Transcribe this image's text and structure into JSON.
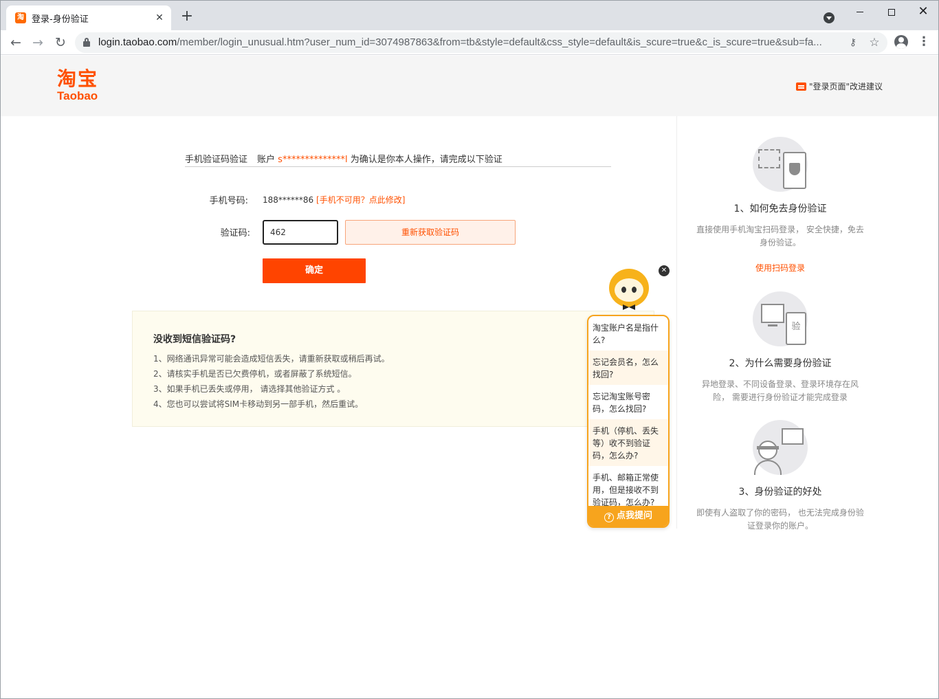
{
  "browser": {
    "tab_title": "登录-身份验证",
    "tab_favicon_text": "淘",
    "url_host": "login.taobao.com",
    "url_path": "/member/login_unusual.htm?user_num_id=3074987863&from=tb&style=default&css_style=default&is_scure=true&c_is_scure=true&sub=fa..."
  },
  "header": {
    "logo_cn": "淘宝",
    "logo_en": "Taobao",
    "feedback_label": "\"登录页面\"改进建议"
  },
  "verify": {
    "tab_label": "手机验证码验证",
    "account_prefix": "账户",
    "account_masked": "s**************l",
    "instruction": "为确认是你本人操作，请完成以下验证",
    "phone_label": "手机号码:",
    "phone_value": "188******86",
    "phone_change": "[手机不可用？点此修改]",
    "code_label": "验证码:",
    "code_value": "462",
    "resend_label": "重新获取验证码",
    "confirm_label": "确定"
  },
  "tips": {
    "title": "没收到短信验证码?",
    "items": [
      "1、网络通讯异常可能会造成短信丢失，请重新获取或稍后再试。",
      "2、请核实手机是否已欠费停机，或者屏蔽了系统短信。",
      "3、如果手机已丢失或停用， 请选择其他验证方式 。",
      "4、您也可以尝试将SIM卡移动到另一部手机，然后重试。"
    ]
  },
  "help": [
    {
      "title": "1、如何免去身份验证",
      "desc": "直接使用手机淘宝扫码登录， 安全快捷，免去身份验证。",
      "link": "使用扫码登录"
    },
    {
      "title": "2、为什么需要身份验证",
      "desc": "异地登录、不同设备登录、登录环境存在风险， 需要进行身份验证才能完成登录"
    },
    {
      "title": "3、身份验证的好处",
      "desc": "即使有人盗取了你的密码， 也无法完成身份验证登录你的账户。"
    }
  ],
  "illus_text": "验",
  "chat": {
    "questions": [
      "淘宝账户名是指什么?",
      "忘记会员名，怎么找回?",
      "忘记淘宝账号密码，怎么找回?",
      "手机（停机、丢失等）收不到验证码，怎么办?",
      "手机、邮箱正常使用，但是接收不到验证码，怎么办?"
    ],
    "ask_label": "点我提问"
  }
}
